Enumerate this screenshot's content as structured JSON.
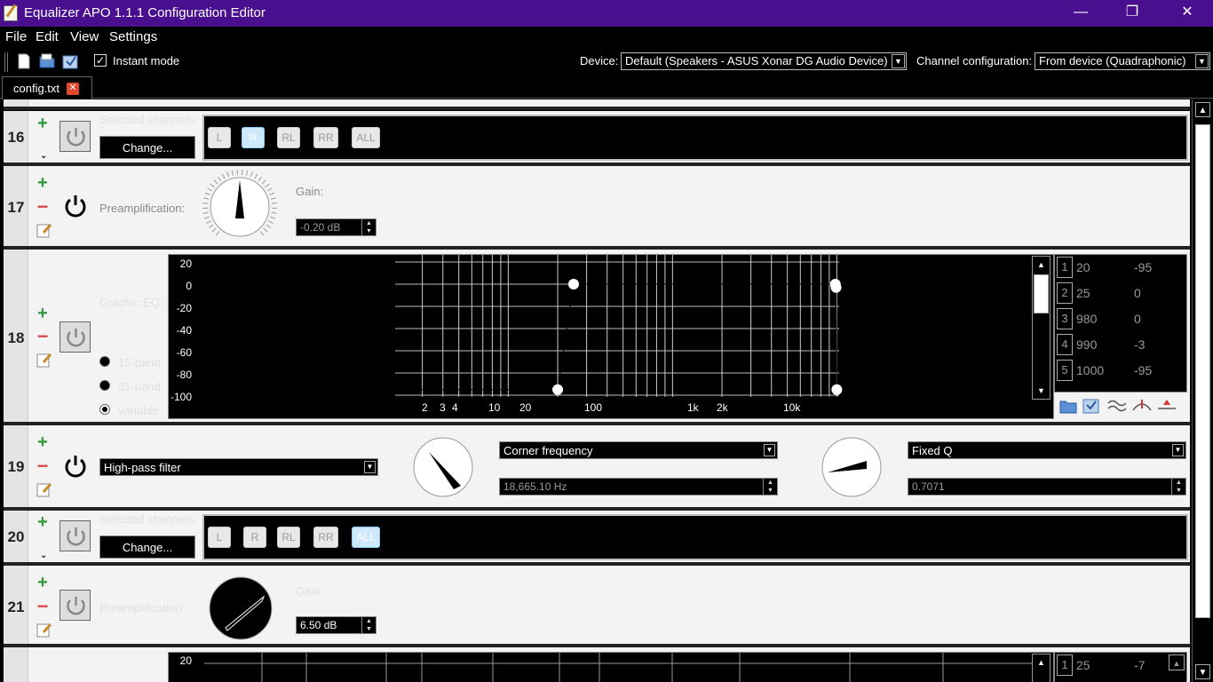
{
  "window": {
    "title": "Equalizer APO 1.1.1 Configuration Editor",
    "minimize": "—",
    "maximize": "❐",
    "close": "✕"
  },
  "menu": [
    "File",
    "Edit",
    "View",
    "Settings"
  ],
  "toolbar": {
    "instant_mode_label": "Instant mode",
    "instant_mode_checked": "✓",
    "device_label": "Device:",
    "device_value": "Default (Speakers - ASUS Xonar DG Audio Device)",
    "channel_config_label": "Channel configuration:",
    "channel_config_value": "From device (Quadraphonic)"
  },
  "tab": {
    "name": "config.txt",
    "close": "✕"
  },
  "rows": {
    "r16": {
      "num": "16",
      "title": "Selected channels:",
      "change": "Change...",
      "channels": [
        "L",
        "R",
        "RL",
        "RR",
        "ALL"
      ],
      "active": "R"
    },
    "r17": {
      "num": "17",
      "label": "Preamplification:",
      "gain_label": "Gain:",
      "gain": "-0.20 dB"
    },
    "r18": {
      "num": "18",
      "title": "Graphic EQ:",
      "radio_15": "15-band",
      "radio_31": "31-band",
      "radio_var": "variable"
    },
    "r19": {
      "num": "19",
      "filter": "High-pass filter",
      "freq_mode": "Corner frequency",
      "freq": "18,665.10 Hz",
      "q_mode": "Fixed Q",
      "q": "0.7071"
    },
    "r20": {
      "num": "20",
      "title": "Selected channels:",
      "change": "Change...",
      "channels": [
        "L",
        "R",
        "RL",
        "RR",
        "ALL"
      ],
      "active": "ALL"
    },
    "r21": {
      "num": "21",
      "label": "Preamplification:",
      "gain_label": "Gain:",
      "gain": "6.50 dB"
    },
    "r22": {
      "band_idx": "1",
      "band_freq": "25",
      "band_gain": "-7",
      "y_top": "20"
    }
  },
  "geq": {
    "y_ticks": [
      "20",
      "0",
      "-20",
      "-40",
      "-60",
      "-80",
      "-100"
    ],
    "x_ticks": [
      "2",
      "3",
      "4",
      "10",
      "20",
      "100",
      "1k",
      "2k",
      "10k"
    ],
    "bands": [
      {
        "idx": "1",
        "freq": "20",
        "gain": "-95"
      },
      {
        "idx": "2",
        "freq": "25",
        "gain": "0"
      },
      {
        "idx": "3",
        "freq": "980",
        "gain": "0"
      },
      {
        "idx": "4",
        "freq": "990",
        "gain": "-3"
      },
      {
        "idx": "5",
        "freq": "1000",
        "gain": "-95"
      }
    ]
  },
  "scroll": {
    "up": "▲",
    "down": "▼"
  }
}
